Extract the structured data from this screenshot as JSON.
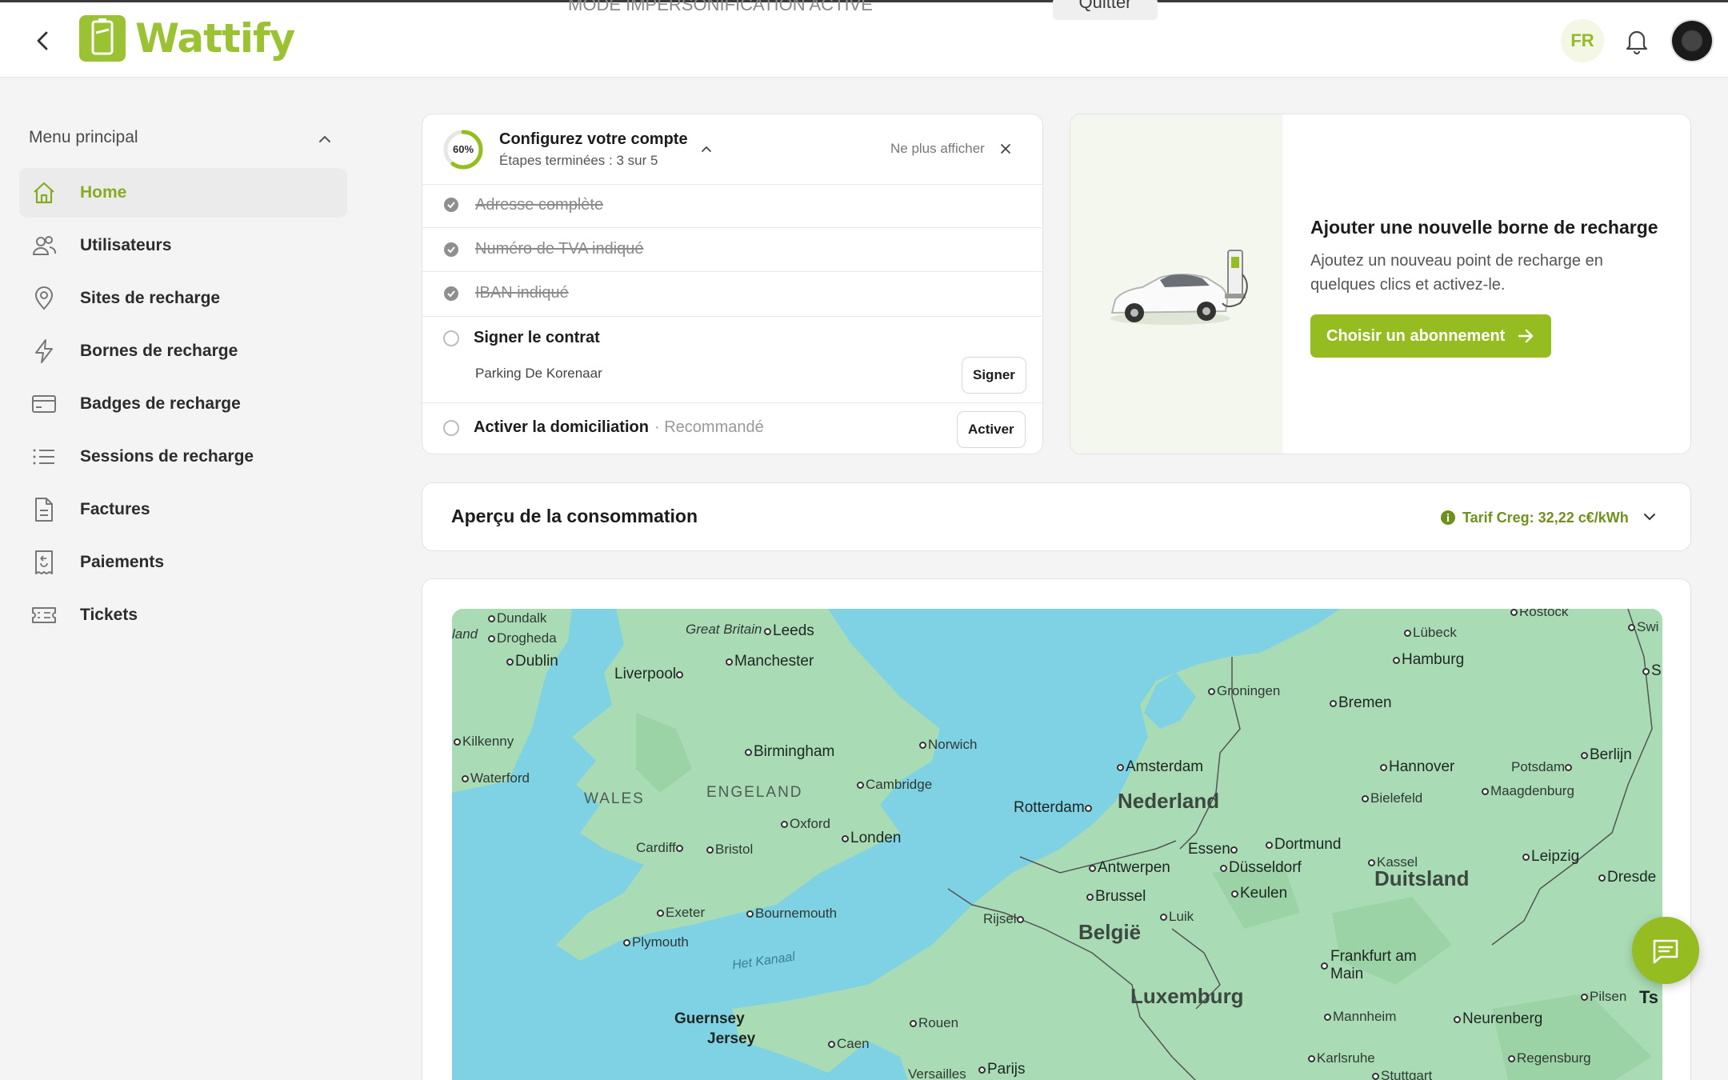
{
  "header": {
    "brand": "Wattify",
    "banner_text": "MODE IMPERSONIFICATION ACTIVE",
    "quit_label": "Quitter",
    "language": "FR"
  },
  "sidebar": {
    "menu_title": "Menu principal",
    "items": [
      {
        "label": "Home",
        "icon": "home-icon"
      },
      {
        "label": "Utilisateurs",
        "icon": "users-icon"
      },
      {
        "label": "Sites de recharge",
        "icon": "map-pin-icon"
      },
      {
        "label": "Bornes de recharge",
        "icon": "lightning-icon"
      },
      {
        "label": "Badges de recharge",
        "icon": "card-icon"
      },
      {
        "label": "Sessions de recharge",
        "icon": "list-icon"
      },
      {
        "label": "Factures",
        "icon": "document-icon"
      },
      {
        "label": "Paiements",
        "icon": "receipt-icon"
      },
      {
        "label": "Tickets",
        "icon": "ticket-icon"
      }
    ]
  },
  "setup": {
    "progress_label": "60%",
    "progress": 0.6,
    "title": "Configurez votre compte",
    "subtitle": "Étapes terminées : 3 sur 5",
    "dismiss_label": "Ne plus afficher",
    "done_tasks": [
      "Adresse complète",
      "Numéro de TVA indiqué",
      "IBAN indiqué"
    ],
    "contract": {
      "label": "Signer le contrat",
      "site": "Parking De Korenaar",
      "button": "Signer"
    },
    "domiciliation": {
      "label": "Activer la domiciliation",
      "tag": "· Recommandé",
      "button": "Activer"
    }
  },
  "add_station": {
    "title": "Ajouter une nouvelle borne de recharge",
    "description": "Ajoutez un nouveau point de recharge en quelques clics et activez-le.",
    "button": "Choisir un abonnement"
  },
  "consumption": {
    "title": "Aperçu de la consommation",
    "tarif": "Tarif Creg: 32,22 c€/kWh"
  },
  "map": {
    "countries": [
      "Nederland",
      "België",
      "Luxemburg",
      "Duitsland"
    ],
    "regions": [
      "WALES",
      "ENGELAND"
    ],
    "seas": [
      "Het Kanaal"
    ],
    "cities": {
      "dundalk": "Dundalk",
      "land": "land",
      "drogheda": "Drogheda",
      "dublin": "Dublin",
      "great_britain": "Great Britain",
      "leeds": "Leeds",
      "liverpool": "Liverpool",
      "manchester": "Manchester",
      "kilkenny": "Kilkenny",
      "waterford": "Waterford",
      "birmingham": "Birmingham",
      "norwich": "Norwich",
      "cambridge": "Cambridge",
      "oxford": "Oxford",
      "cardiff": "Cardiff",
      "bristol": "Bristol",
      "london": "Londen",
      "exeter": "Exeter",
      "bournemouth": "Bournemouth",
      "plymouth": "Plymouth",
      "guernsey": "Guernsey",
      "jersey": "Jersey",
      "caen": "Caen",
      "rouen": "Rouen",
      "versailles": "Versailles",
      "paris": "Parijs",
      "amsterdam": "Amsterdam",
      "rotterdam": "Rotterdam",
      "groningen": "Groningen",
      "bremen": "Bremen",
      "hamburg": "Hamburg",
      "lubeck": "Lübeck",
      "rostock": "Rostock",
      "swi": "Swi",
      "hannover": "Hannover",
      "potsdam": "Potsdam",
      "berlin": "Berlijn",
      "bielefeld": "Bielefeld",
      "magdeburg": "Maagdenburg",
      "essen": "Essen",
      "dortmund": "Dortmund",
      "kassel": "Kassel",
      "leipzig": "Leipzig",
      "antwerp": "Antwerpen",
      "dusseldorf": "Düsseldorf",
      "dresden": "Dresde",
      "brussels": "Brussel",
      "keulen": "Keulen",
      "luik": "Luik",
      "rijsel": "Rijsel",
      "frankfurt": "Frankfurt am Main",
      "pilsen": "Pilsen",
      "mannheim": "Mannheim",
      "neurenberg": "Neurenberg",
      "karlsruhe": "Karlsruhe",
      "stuttgart": "Stuttgart",
      "regensburg": "Regensburg",
      "ts": "Ts",
      "s": "S"
    }
  },
  "colors": {
    "accent": "#95bd22",
    "accent_text": "#86ad22",
    "water": "#7fd1e4",
    "land": "#a9dcb4"
  }
}
